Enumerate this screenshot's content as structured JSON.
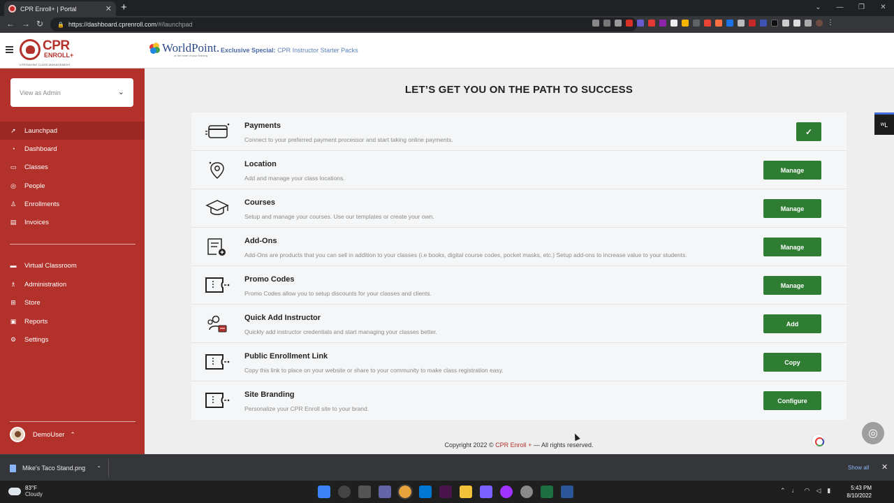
{
  "browser": {
    "tab_title": "CPR Enroll+ | Portal",
    "url_host": "https://dashboard.cprenroll.com",
    "url_path": "/#/launchpad"
  },
  "header": {
    "logo_main": "CPR",
    "logo_sub": "ENROLL+",
    "logo_tag": "LIFESAVING CLASS MANAGEMENT",
    "partner_name": "WorldPoint.",
    "partner_tag": "at the heart of your training",
    "promo_label": "Exclusive Special:",
    "promo_text": "CPR Instructor Starter Packs"
  },
  "sidebar": {
    "view_as": "View as Admin",
    "items": [
      {
        "label": "Launchpad",
        "icon": "rocket-icon"
      },
      {
        "label": "Dashboard",
        "icon": "gauge-icon"
      },
      {
        "label": "Classes",
        "icon": "book-icon"
      },
      {
        "label": "People",
        "icon": "person-icon"
      },
      {
        "label": "Enrollments",
        "icon": "enroll-icon"
      },
      {
        "label": "Invoices",
        "icon": "invoice-icon"
      },
      {
        "label": "Virtual Classroom",
        "icon": "monitor-icon"
      },
      {
        "label": "Administration",
        "icon": "admin-icon"
      },
      {
        "label": "Store",
        "icon": "cart-icon"
      },
      {
        "label": "Reports",
        "icon": "reports-icon"
      },
      {
        "label": "Settings",
        "icon": "gear-icon"
      }
    ],
    "user": "DemoUser"
  },
  "main": {
    "title": "LET’S GET YOU ON THE PATH TO SUCCESS",
    "rows": [
      {
        "title": "Payments",
        "desc": "Connect to your preferred payment processor and start taking online payments.",
        "button": "✓",
        "icon": "card-icon"
      },
      {
        "title": "Location",
        "desc": "Add and manage your class locations.",
        "button": "Manage",
        "icon": "location-pin-icon"
      },
      {
        "title": "Courses",
        "desc": "Setup and manage your courses. Use our templates or create your own.",
        "button": "Manage",
        "icon": "graduation-cap-icon"
      },
      {
        "title": "Add-Ons",
        "desc": "Add-Ons are products that you can sell in addition to your classes (i.e books, digital course codes, pocket masks, etc.) Setup add-ons to increase value to your students.",
        "button": "Manage",
        "icon": "add-list-icon"
      },
      {
        "title": "Promo Codes",
        "desc": "Promo Codes allow you to setup discounts for your classes and clients.",
        "button": "Manage",
        "icon": "ticket-icon"
      },
      {
        "title": "Quick Add Instructor",
        "desc": "Quickly add instructor credentials and start managing your classes better.",
        "button": "Add",
        "icon": "instructor-icon"
      },
      {
        "title": "Public Enrollment Link",
        "desc": "Copy this link to place on your website or share to your community to make class registration easy.",
        "button": "Copy",
        "icon": "ticket-icon"
      },
      {
        "title": "Site Branding",
        "desc": "Personalize your CPR Enroll site to your brand.",
        "button": "Configure",
        "icon": "ticket-icon"
      }
    ],
    "footer_pre": "Copyright 2022 ©",
    "footer_brand": "CPR Enroll +",
    "footer_post": "— All rights reserved."
  },
  "downloads": {
    "file": "Mike's Taco Stand.png",
    "show_all": "Show all"
  },
  "taskbar": {
    "temp": "83°F",
    "condition": "Cloudy",
    "time": "5:43 PM",
    "date": "8/10/2022"
  },
  "colors": {
    "brand_red": "#b3312b",
    "button_green": "#2e7d32"
  }
}
